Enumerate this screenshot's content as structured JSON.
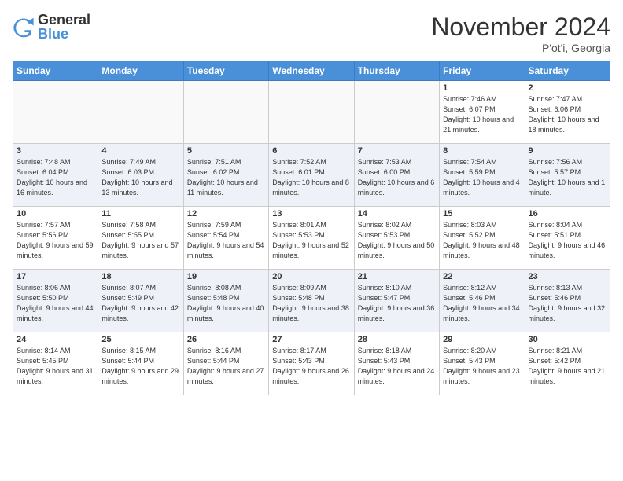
{
  "header": {
    "logo_general": "General",
    "logo_blue": "Blue",
    "month_title": "November 2024",
    "subtitle": "P'ot'i, Georgia"
  },
  "days_of_week": [
    "Sunday",
    "Monday",
    "Tuesday",
    "Wednesday",
    "Thursday",
    "Friday",
    "Saturday"
  ],
  "weeks": [
    [
      {
        "day": "",
        "info": ""
      },
      {
        "day": "",
        "info": ""
      },
      {
        "day": "",
        "info": ""
      },
      {
        "day": "",
        "info": ""
      },
      {
        "day": "",
        "info": ""
      },
      {
        "day": "1",
        "info": "Sunrise: 7:46 AM\nSunset: 6:07 PM\nDaylight: 10 hours and 21 minutes."
      },
      {
        "day": "2",
        "info": "Sunrise: 7:47 AM\nSunset: 6:06 PM\nDaylight: 10 hours and 18 minutes."
      }
    ],
    [
      {
        "day": "3",
        "info": "Sunrise: 7:48 AM\nSunset: 6:04 PM\nDaylight: 10 hours and 16 minutes."
      },
      {
        "day": "4",
        "info": "Sunrise: 7:49 AM\nSunset: 6:03 PM\nDaylight: 10 hours and 13 minutes."
      },
      {
        "day": "5",
        "info": "Sunrise: 7:51 AM\nSunset: 6:02 PM\nDaylight: 10 hours and 11 minutes."
      },
      {
        "day": "6",
        "info": "Sunrise: 7:52 AM\nSunset: 6:01 PM\nDaylight: 10 hours and 8 minutes."
      },
      {
        "day": "7",
        "info": "Sunrise: 7:53 AM\nSunset: 6:00 PM\nDaylight: 10 hours and 6 minutes."
      },
      {
        "day": "8",
        "info": "Sunrise: 7:54 AM\nSunset: 5:59 PM\nDaylight: 10 hours and 4 minutes."
      },
      {
        "day": "9",
        "info": "Sunrise: 7:56 AM\nSunset: 5:57 PM\nDaylight: 10 hours and 1 minute."
      }
    ],
    [
      {
        "day": "10",
        "info": "Sunrise: 7:57 AM\nSunset: 5:56 PM\nDaylight: 9 hours and 59 minutes."
      },
      {
        "day": "11",
        "info": "Sunrise: 7:58 AM\nSunset: 5:55 PM\nDaylight: 9 hours and 57 minutes."
      },
      {
        "day": "12",
        "info": "Sunrise: 7:59 AM\nSunset: 5:54 PM\nDaylight: 9 hours and 54 minutes."
      },
      {
        "day": "13",
        "info": "Sunrise: 8:01 AM\nSunset: 5:53 PM\nDaylight: 9 hours and 52 minutes."
      },
      {
        "day": "14",
        "info": "Sunrise: 8:02 AM\nSunset: 5:53 PM\nDaylight: 9 hours and 50 minutes."
      },
      {
        "day": "15",
        "info": "Sunrise: 8:03 AM\nSunset: 5:52 PM\nDaylight: 9 hours and 48 minutes."
      },
      {
        "day": "16",
        "info": "Sunrise: 8:04 AM\nSunset: 5:51 PM\nDaylight: 9 hours and 46 minutes."
      }
    ],
    [
      {
        "day": "17",
        "info": "Sunrise: 8:06 AM\nSunset: 5:50 PM\nDaylight: 9 hours and 44 minutes."
      },
      {
        "day": "18",
        "info": "Sunrise: 8:07 AM\nSunset: 5:49 PM\nDaylight: 9 hours and 42 minutes."
      },
      {
        "day": "19",
        "info": "Sunrise: 8:08 AM\nSunset: 5:48 PM\nDaylight: 9 hours and 40 minutes."
      },
      {
        "day": "20",
        "info": "Sunrise: 8:09 AM\nSunset: 5:48 PM\nDaylight: 9 hours and 38 minutes."
      },
      {
        "day": "21",
        "info": "Sunrise: 8:10 AM\nSunset: 5:47 PM\nDaylight: 9 hours and 36 minutes."
      },
      {
        "day": "22",
        "info": "Sunrise: 8:12 AM\nSunset: 5:46 PM\nDaylight: 9 hours and 34 minutes."
      },
      {
        "day": "23",
        "info": "Sunrise: 8:13 AM\nSunset: 5:46 PM\nDaylight: 9 hours and 32 minutes."
      }
    ],
    [
      {
        "day": "24",
        "info": "Sunrise: 8:14 AM\nSunset: 5:45 PM\nDaylight: 9 hours and 31 minutes."
      },
      {
        "day": "25",
        "info": "Sunrise: 8:15 AM\nSunset: 5:44 PM\nDaylight: 9 hours and 29 minutes."
      },
      {
        "day": "26",
        "info": "Sunrise: 8:16 AM\nSunset: 5:44 PM\nDaylight: 9 hours and 27 minutes."
      },
      {
        "day": "27",
        "info": "Sunrise: 8:17 AM\nSunset: 5:43 PM\nDaylight: 9 hours and 26 minutes."
      },
      {
        "day": "28",
        "info": "Sunrise: 8:18 AM\nSunset: 5:43 PM\nDaylight: 9 hours and 24 minutes."
      },
      {
        "day": "29",
        "info": "Sunrise: 8:20 AM\nSunset: 5:43 PM\nDaylight: 9 hours and 23 minutes."
      },
      {
        "day": "30",
        "info": "Sunrise: 8:21 AM\nSunset: 5:42 PM\nDaylight: 9 hours and 21 minutes."
      }
    ]
  ]
}
